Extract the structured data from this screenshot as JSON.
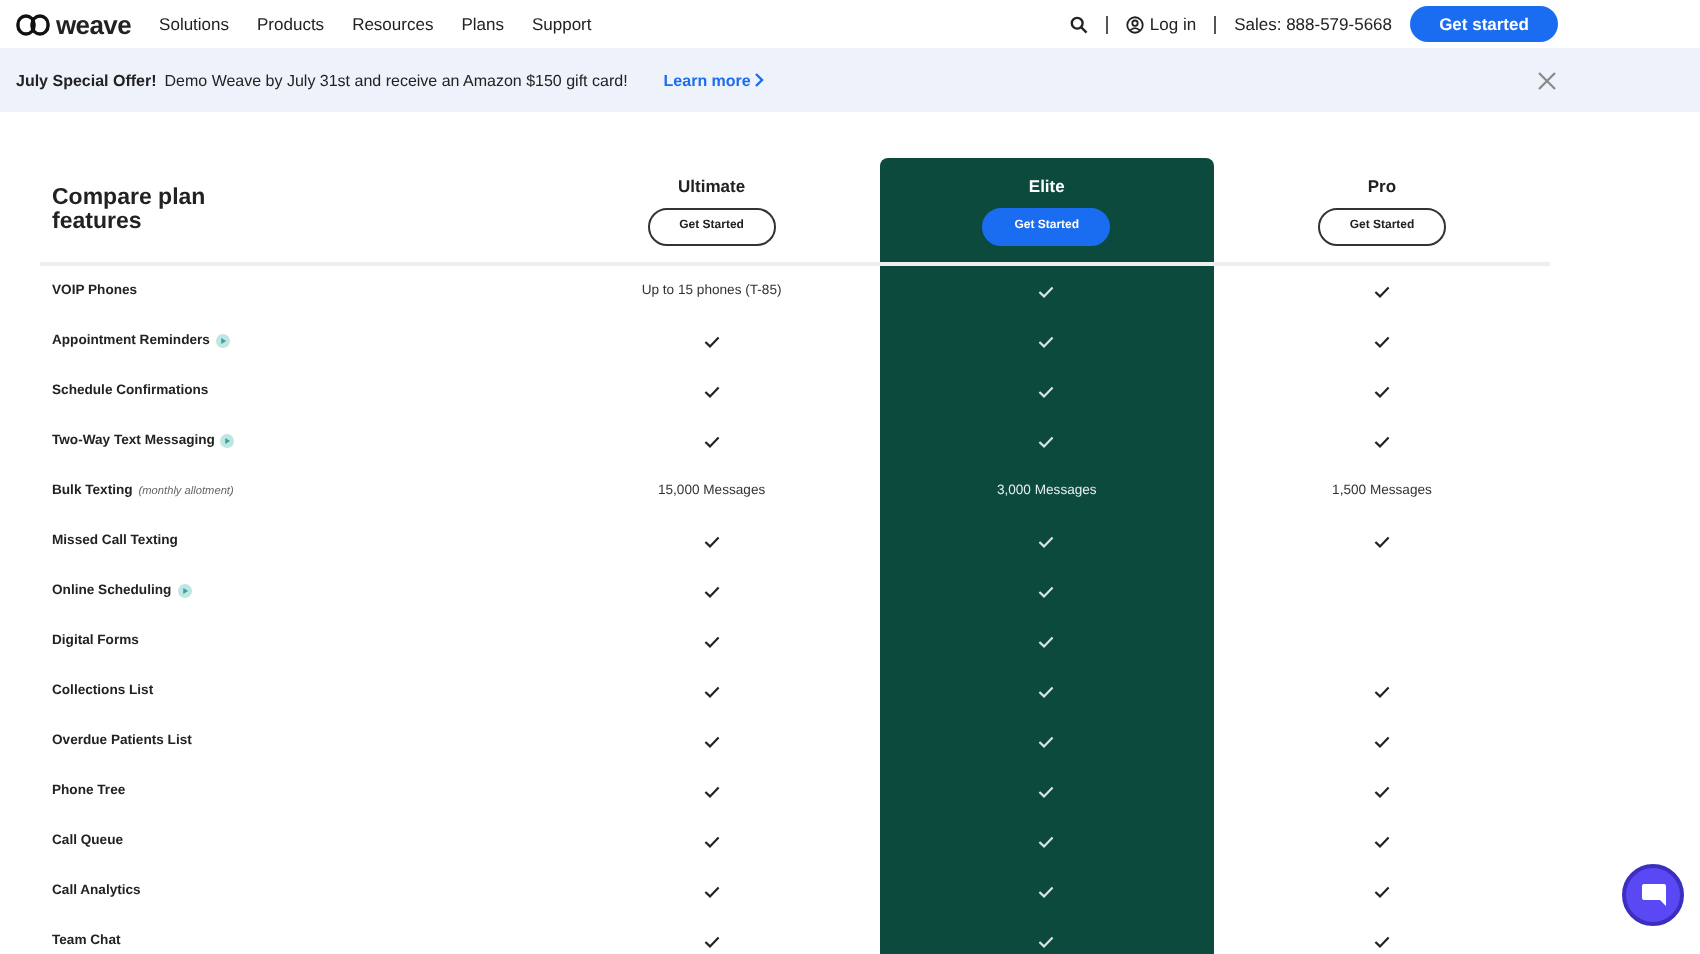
{
  "nav": {
    "logo": "weave",
    "links": [
      "Solutions",
      "Products",
      "Resources",
      "Plans",
      "Support"
    ],
    "login": "Log in",
    "sales": "Sales: 888-579-5668",
    "cta": "Get started"
  },
  "banner": {
    "title": "July Special Offer!",
    "text": "Demo Weave by July 31st and receive an Amazon $150 gift card!",
    "link": "Learn more"
  },
  "table": {
    "title": "Compare plan features",
    "plans": [
      {
        "name": "Ultimate",
        "button": "Get Started",
        "highlighted": false
      },
      {
        "name": "Elite",
        "button": "Get Started",
        "highlighted": true
      },
      {
        "name": "Pro",
        "button": "Get Started",
        "highlighted": false
      }
    ],
    "rows": [
      {
        "feature": "VOIP Phones",
        "video": false,
        "cells": [
          {
            "kind": "text",
            "text": "Up to 15 phones (T-85)"
          },
          {
            "kind": "check"
          },
          {
            "kind": "check"
          }
        ]
      },
      {
        "feature": "Appointment Reminders",
        "video": true,
        "cells": [
          {
            "kind": "check"
          },
          {
            "kind": "check"
          },
          {
            "kind": "check"
          }
        ]
      },
      {
        "feature": "Schedule Confirmations",
        "video": false,
        "cells": [
          {
            "kind": "check"
          },
          {
            "kind": "check"
          },
          {
            "kind": "check"
          }
        ]
      },
      {
        "feature": "Two-Way Text Messaging",
        "video": true,
        "cells": [
          {
            "kind": "check"
          },
          {
            "kind": "check"
          },
          {
            "kind": "check"
          }
        ]
      },
      {
        "feature": "Bulk Texting",
        "note": "(monthly allotment)",
        "video": false,
        "cells": [
          {
            "kind": "text",
            "text": "15,000 Messages"
          },
          {
            "kind": "text",
            "text": "3,000 Messages"
          },
          {
            "kind": "text",
            "text": "1,500 Messages"
          }
        ]
      },
      {
        "feature": "Missed Call Texting",
        "video": false,
        "cells": [
          {
            "kind": "check"
          },
          {
            "kind": "check"
          },
          {
            "kind": "check"
          }
        ]
      },
      {
        "feature": "Online Scheduling",
        "video": true,
        "cells": [
          {
            "kind": "check"
          },
          {
            "kind": "check"
          },
          {
            "kind": "empty"
          }
        ]
      },
      {
        "feature": "Digital Forms",
        "video": false,
        "cells": [
          {
            "kind": "check"
          },
          {
            "kind": "check"
          },
          {
            "kind": "empty"
          }
        ]
      },
      {
        "feature": "Collections List",
        "video": false,
        "cells": [
          {
            "kind": "check"
          },
          {
            "kind": "check"
          },
          {
            "kind": "check"
          }
        ]
      },
      {
        "feature": "Overdue Patients List",
        "video": false,
        "cells": [
          {
            "kind": "check"
          },
          {
            "kind": "check"
          },
          {
            "kind": "check"
          }
        ]
      },
      {
        "feature": "Phone Tree",
        "video": false,
        "cells": [
          {
            "kind": "check"
          },
          {
            "kind": "check"
          },
          {
            "kind": "check"
          }
        ]
      },
      {
        "feature": "Call Queue",
        "video": false,
        "cells": [
          {
            "kind": "check"
          },
          {
            "kind": "check"
          },
          {
            "kind": "check"
          }
        ]
      },
      {
        "feature": "Call Analytics",
        "video": false,
        "cells": [
          {
            "kind": "check"
          },
          {
            "kind": "check"
          },
          {
            "kind": "check"
          }
        ]
      },
      {
        "feature": "Team Chat",
        "video": false,
        "cells": [
          {
            "kind": "check"
          },
          {
            "kind": "check"
          },
          {
            "kind": "check"
          }
        ]
      }
    ]
  }
}
